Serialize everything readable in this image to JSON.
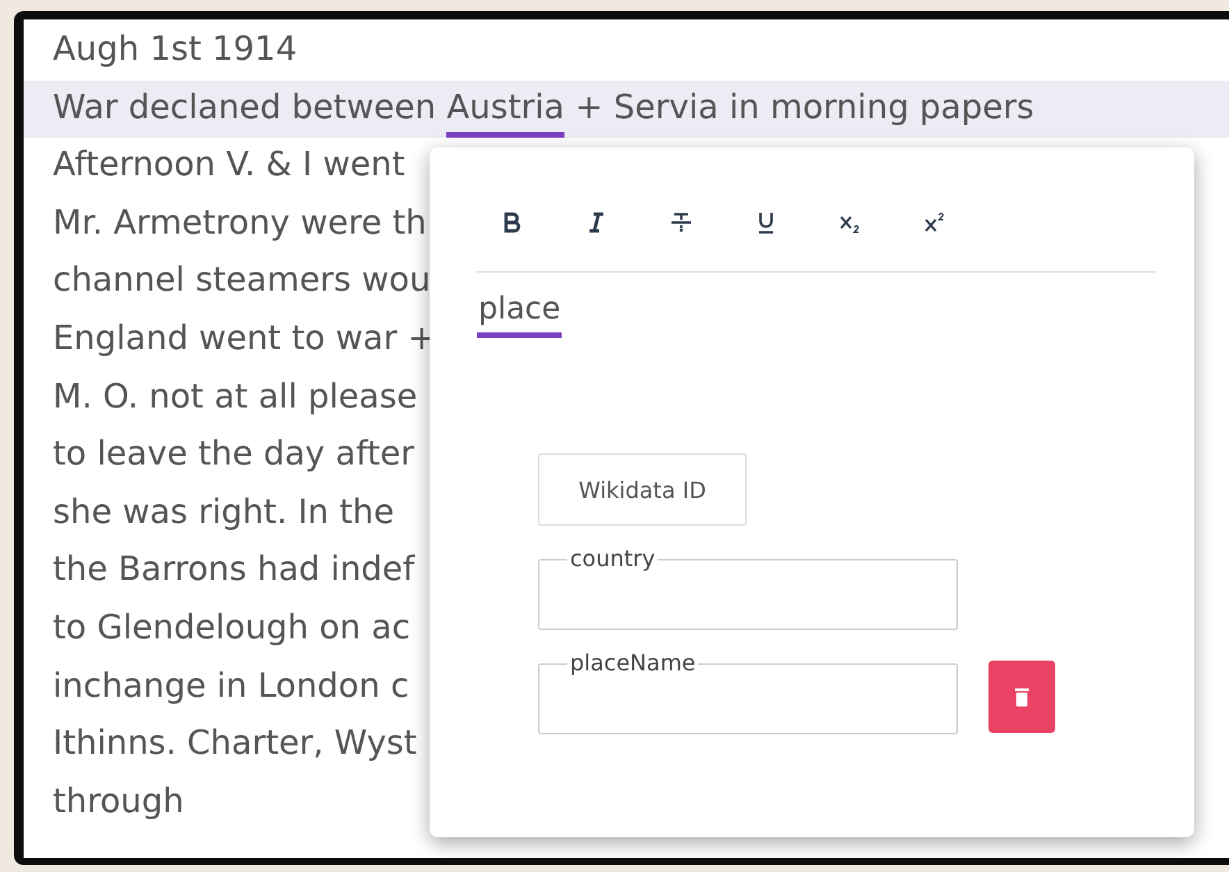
{
  "transcript": {
    "lines": [
      {
        "highlighted": false,
        "segments": [
          {
            "text": "Augh 1st 1914",
            "tagged": false
          }
        ]
      },
      {
        "highlighted": true,
        "segments": [
          {
            "text": "War declaned between ",
            "tagged": false
          },
          {
            "text": "Austria",
            "tagged": true
          },
          {
            "text": " + Servia in morning papers",
            "tagged": false
          }
        ]
      },
      {
        "highlighted": false,
        "segments": [
          {
            "text": "Afternoon V. & I went",
            "tagged": false
          }
        ]
      },
      {
        "highlighted": false,
        "segments": [
          {
            "text": "Mr. Armetrony were th",
            "tagged": false
          }
        ]
      },
      {
        "highlighted": false,
        "segments": [
          {
            "text": "channel steamers wou",
            "tagged": false
          }
        ]
      },
      {
        "highlighted": false,
        "segments": [
          {
            "text": "England went to war +",
            "tagged": false
          }
        ]
      },
      {
        "highlighted": false,
        "segments": [
          {
            "text": "M. O. not at all please",
            "tagged": false
          }
        ]
      },
      {
        "highlighted": false,
        "segments": [
          {
            "text": "to leave the day after",
            "tagged": false
          }
        ]
      },
      {
        "highlighted": false,
        "segments": [
          {
            "text": "she was right. In the",
            "tagged": false
          }
        ]
      },
      {
        "highlighted": false,
        "segments": [
          {
            "text": "the Barrons had indef",
            "tagged": false
          }
        ]
      },
      {
        "highlighted": false,
        "segments": [
          {
            "text": "to Glendelough on ac",
            "tagged": false
          }
        ]
      },
      {
        "highlighted": false,
        "segments": [
          {
            "text": "inchange in London c",
            "tagged": false
          }
        ]
      },
      {
        "highlighted": false,
        "segments": [
          {
            "text": "Ithinns. Charter, Wyst",
            "tagged": false
          }
        ]
      },
      {
        "highlighted": false,
        "segments": [
          {
            "text": "through",
            "tagged": false
          }
        ]
      }
    ]
  },
  "popup": {
    "toolbar": [
      {
        "kind": "bold"
      },
      {
        "kind": "italic"
      },
      {
        "kind": "strikethrough"
      },
      {
        "kind": "underline"
      },
      {
        "kind": "subscript"
      },
      {
        "kind": "superscript"
      }
    ],
    "tabs": [
      {
        "label": "place",
        "selected": true
      }
    ],
    "wikidata_button": "Wikidata ID",
    "fields": [
      {
        "label": "country",
        "deletable": false
      },
      {
        "label": "placeName",
        "deletable": true
      }
    ]
  }
}
